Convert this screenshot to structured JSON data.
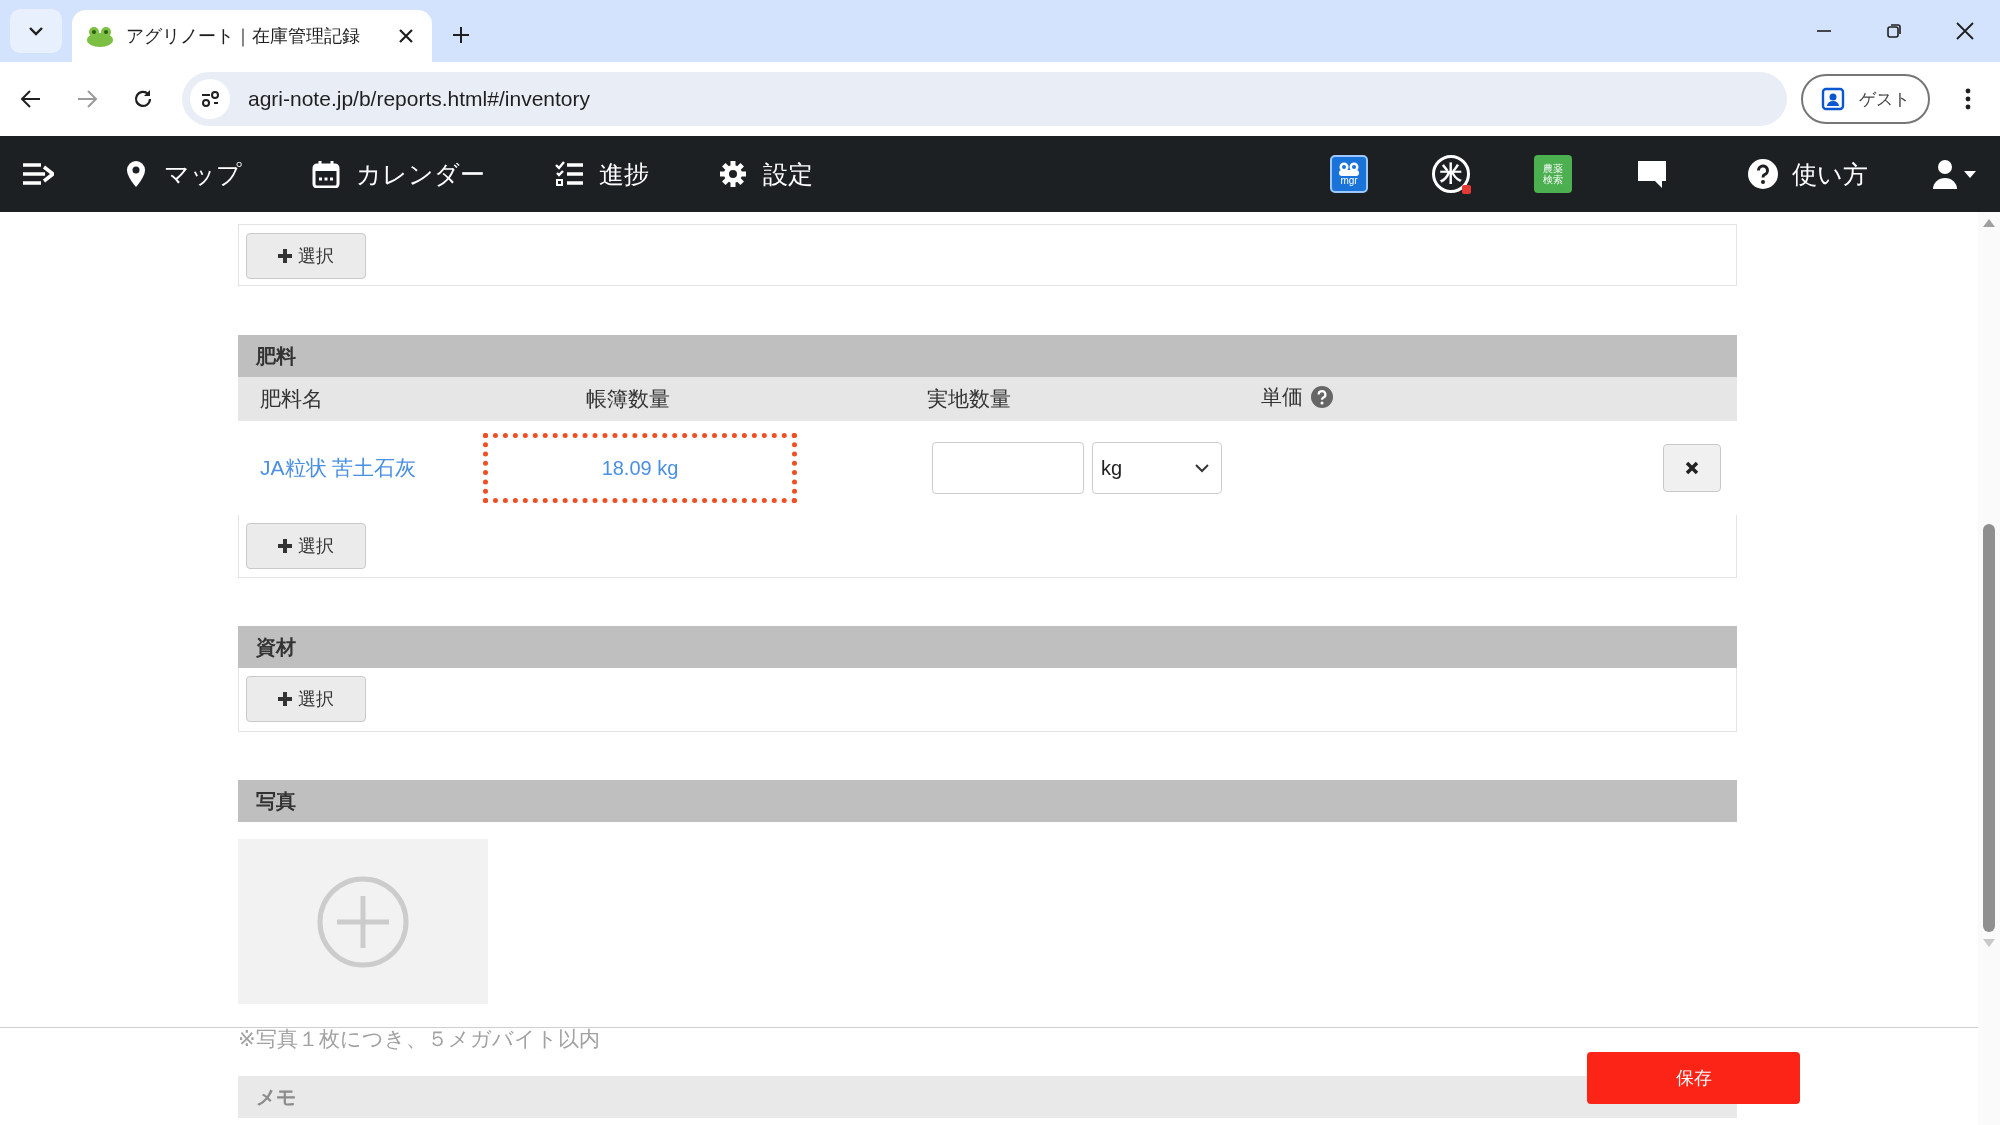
{
  "browser": {
    "tabs": [
      {
        "title": "アグリノート｜在庫管理記録",
        "selected": true
      }
    ],
    "url": "agri-note.jp/b/reports.html#/inventory",
    "profile_label": "ゲスト"
  },
  "nav": {
    "items": [
      {
        "kind": "map",
        "label": "マップ"
      },
      {
        "kind": "calendar",
        "label": "カレンダー"
      },
      {
        "kind": "progress",
        "label": "進捗"
      },
      {
        "kind": "settings",
        "label": "設定"
      }
    ],
    "apps": [
      {
        "kind": "mgr",
        "text": "mgr"
      },
      {
        "kind": "rice",
        "text": "米"
      },
      {
        "kind": "book",
        "text": "農薬検索"
      },
      {
        "kind": "chat"
      }
    ],
    "help_label": "使い方"
  },
  "top_section": {
    "select_button": "選択"
  },
  "fertilizer": {
    "title": "肥料",
    "columns": [
      "肥料名",
      "帳簿数量",
      "実地数量",
      "単価"
    ],
    "rows": [
      {
        "name": "JA粒状 苦土石灰",
        "book_quantity": "18.09 kg",
        "highlighted": true,
        "unit": "kg"
      }
    ],
    "select_button": "選択"
  },
  "materials": {
    "title": "資材",
    "select_button": "選択"
  },
  "photos": {
    "title": "写真",
    "note": "※写真１枚につき、５メガバイト以内"
  },
  "memo": {
    "title": "メモ"
  },
  "save_button": "保存"
}
